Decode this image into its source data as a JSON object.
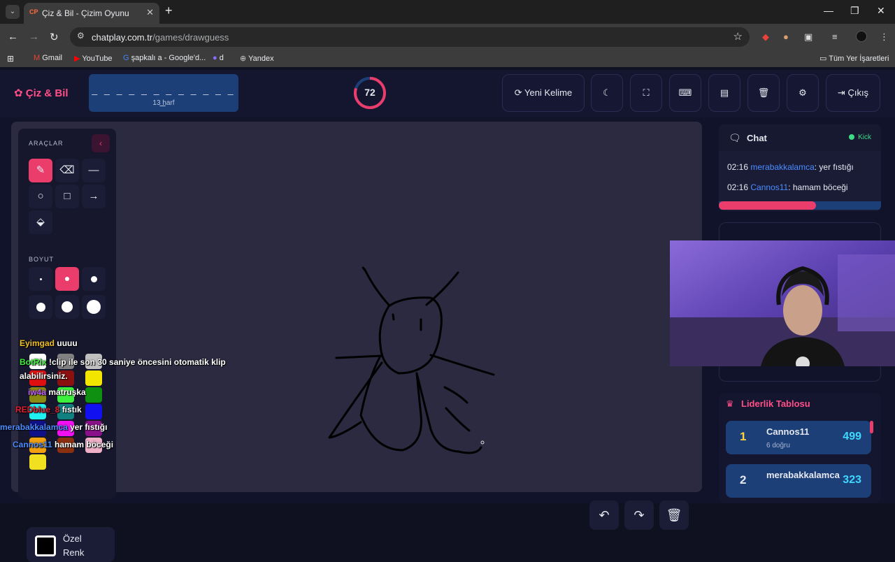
{
  "browser": {
    "tab_favicon": "CP",
    "tab_title": "Çiz & Bil - Çizim Oyunu",
    "url_host": "chatplay.com.tr",
    "url_path": "/games/drawguess",
    "bookmarks": [
      "Gmail",
      "YouTube",
      "şapkalı a - Google'd...",
      "d",
      "Yandex"
    ],
    "all_bookmarks": "Tüm Yer İşaretleri"
  },
  "header": {
    "logo": "Çiz & Bil",
    "word_dashes": "_ _ _ _ _ _ _ _ _ _ _ _ _",
    "word_length": "13 harf",
    "timer": "72",
    "timer_fraction": 0.8,
    "new_word": "Yeni Kelime",
    "exit": "Çıkış"
  },
  "tools": {
    "title": "ARAÇLAR",
    "size_title": "BOYUT",
    "custom_color": "Özel Renk",
    "swatches": [
      "#ffffff",
      "#808080",
      "#c0c0c0",
      "#e01010",
      "#8b1010",
      "#f2e600",
      "#8a8a10",
      "#3ef03e",
      "#109010",
      "#20f0f0",
      "#108080",
      "#1010f0",
      "#10108a",
      "#f010f0",
      "#8a108a",
      "#f0a010",
      "#8a3010",
      "#f0b0c8",
      "#f0e020"
    ]
  },
  "overlay_chat": [
    {
      "user": "Eyimgad",
      "text": "uuuu",
      "color": "#f0c020"
    },
    {
      "user": "BotRix",
      "text": "!clip ile son 30 saniye öncesini otomatik klip alabilirsiniz.",
      "color": "#3ef03e"
    },
    {
      "user": "iw4a",
      "text": "matruşka",
      "color": "#c060ff"
    },
    {
      "user": "REDblue_8",
      "text": "fıstık",
      "color": "#e02030"
    },
    {
      "user": "merabakkalamca",
      "text": "yer fıstığı",
      "color": "#4b8cff"
    },
    {
      "user": "Cannos11",
      "text": "hamam böceği",
      "color": "#4b8cff"
    }
  ],
  "chat": {
    "title": "Chat",
    "status": "Kick",
    "messages": [
      {
        "time": "02:16",
        "user": "merabakkalamca",
        "text": ": yer fıstığı"
      },
      {
        "time": "02:16",
        "user": "Cannos11",
        "text": ": hamam böceği"
      }
    ],
    "progress": 0.6
  },
  "leaderboard": {
    "title": "Liderlik Tablosu",
    "rows": [
      {
        "rank": "1",
        "name": "Cannos11",
        "sub": "6 doğru",
        "score": "499"
      },
      {
        "rank": "2",
        "name": "merabakkalamca",
        "sub": "",
        "score": "323"
      }
    ]
  },
  "icons": {
    "brush": "paintbrush-icon",
    "eraser": "eraser-icon",
    "line": "line-icon",
    "circle": "circle-icon",
    "square": "square-icon",
    "arrow": "arrow-icon",
    "fill": "paint-bucket-icon"
  },
  "colors": {
    "accent": "#ea3d6c",
    "word_box": "#1c3f78",
    "canvas": "#2b2a40"
  }
}
